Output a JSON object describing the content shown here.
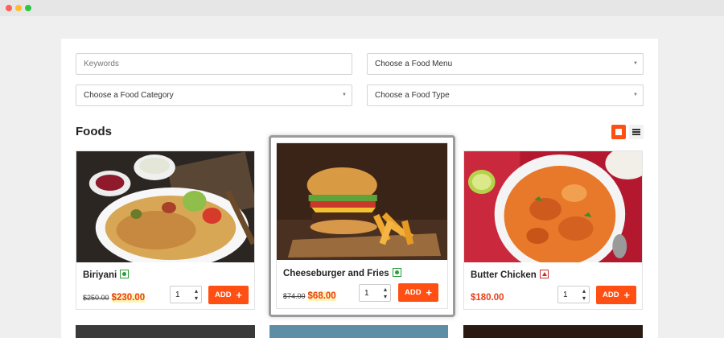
{
  "filters": {
    "keywords_placeholder": "Keywords",
    "food_menu": "Choose a Food Menu",
    "food_category": "Choose a Food Category",
    "food_type": "Choose a Food Type"
  },
  "section_title": "Foods",
  "view_toggle": {
    "grid_icon": "grid-view-icon",
    "list_icon": "list-view-icon",
    "active": "grid"
  },
  "accent_color": "#ff4f12",
  "cards": [
    {
      "name": "Biriyani",
      "diet": "veg",
      "old_price": "$250.00",
      "price": "$230.00",
      "qty": "1",
      "add_label": "ADD"
    },
    {
      "name": "Cheeseburger and Fries",
      "diet": "veg",
      "old_price": "$74.00",
      "price": "$68.00",
      "qty": "1",
      "add_label": "ADD"
    },
    {
      "name": "Butter Chicken",
      "diet": "non-veg",
      "price": "$180.00",
      "qty": "1",
      "add_label": "ADD"
    }
  ]
}
